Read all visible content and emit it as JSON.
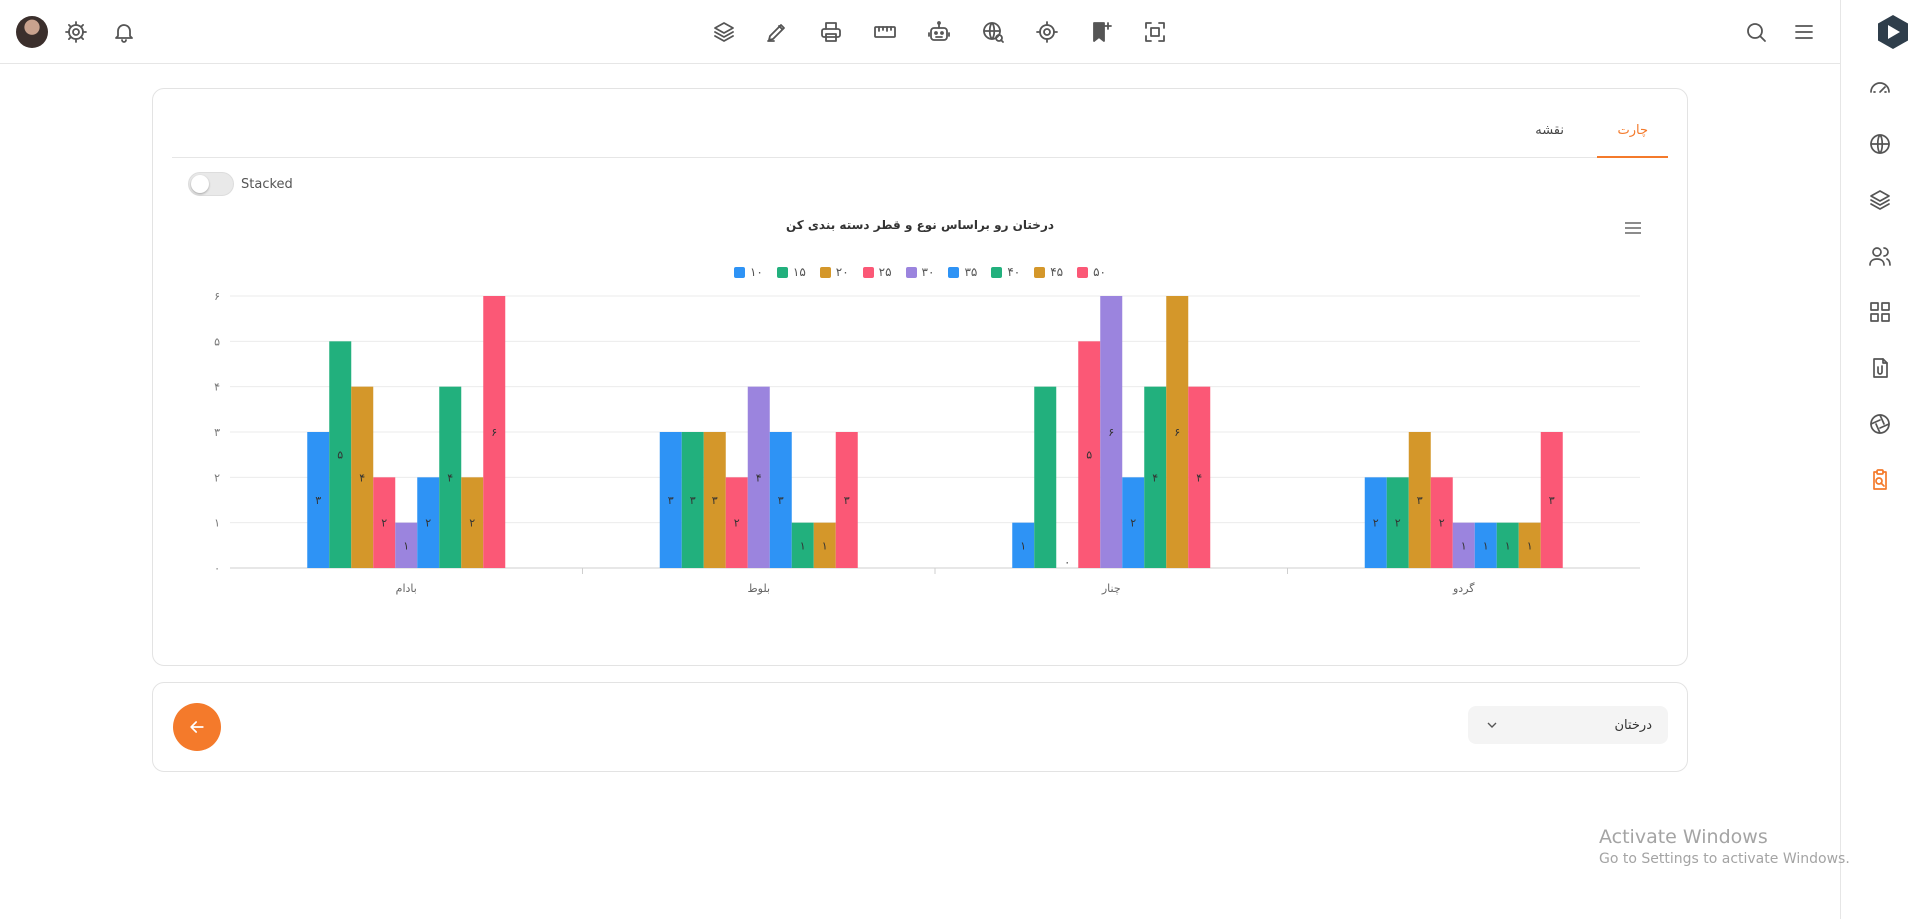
{
  "tabs": {
    "active": "چارت",
    "second": "نقشه"
  },
  "toggle": {
    "label": "Stacked",
    "on": false
  },
  "bottom": {
    "select_value": "درختان"
  },
  "watermark": {
    "line1": "Activate Windows",
    "line2": "Go to Settings to activate Windows."
  },
  "topbar_icons": [
    "avatar",
    "settings-icon",
    "bell-icon",
    "layers-icon",
    "edit-icon",
    "print-icon",
    "ruler-icon",
    "robot-icon",
    "globe-search-icon",
    "target-icon",
    "bookmark-add-icon",
    "scan-icon",
    "search-icon",
    "hamburger-icon"
  ],
  "sidebar_icons": [
    "speedometer-icon",
    "globe-icon",
    "layers-icon",
    "users-icon",
    "grid-icon",
    "file-attach-icon",
    "aperture-icon",
    "clipboard-search-icon"
  ],
  "accent_color": "#f47a2b",
  "chart_data": {
    "type": "bar",
    "title": "درختان رو براساس نوع و قطر دسته بندی کن",
    "xlabel": "",
    "ylabel": "",
    "ylim": [
      0,
      6
    ],
    "yticks": [
      "۰",
      "۱",
      "۲",
      "۳",
      "۴",
      "۵",
      "۶"
    ],
    "grid": true,
    "legend_position": "top",
    "categories": [
      "بادام",
      "بلوط",
      "چنار",
      "گردو"
    ],
    "series": [
      {
        "name": "۱۰",
        "color": "#2e93f5",
        "values": [
          3,
          3,
          1,
          2
        ],
        "labels": [
          "۳",
          "۳",
          "۱",
          "۲"
        ]
      },
      {
        "name": "۱۵",
        "color": "#22b07d",
        "values": [
          5,
          3,
          4,
          2
        ],
        "labels": [
          "۵",
          "۳",
          "",
          "۲"
        ]
      },
      {
        "name": "۲۰",
        "color": "#d4972a",
        "values": [
          4,
          3,
          0,
          3
        ],
        "labels": [
          "۴",
          "۳",
          "۰",
          "۳"
        ]
      },
      {
        "name": "۲۵",
        "color": "#fb5876",
        "values": [
          2,
          2,
          5,
          2
        ],
        "labels": [
          "۲",
          "۲",
          "۵",
          "۲"
        ]
      },
      {
        "name": "۳۰",
        "color": "#9b84de",
        "values": [
          1,
          4,
          6,
          1
        ],
        "labels": [
          "۱",
          "۴",
          "۶",
          "۱"
        ]
      },
      {
        "name": "۳۵",
        "color": "#2e93f5",
        "values": [
          2,
          3,
          2,
          1
        ],
        "labels": [
          "۲",
          "۳",
          "۲",
          "۱"
        ]
      },
      {
        "name": "۴۰",
        "color": "#22b07d",
        "values": [
          4,
          1,
          4,
          1
        ],
        "labels": [
          "۴",
          "۱",
          "۴",
          "۱"
        ]
      },
      {
        "name": "۴۵",
        "color": "#d4972a",
        "values": [
          2,
          1,
          6,
          1
        ],
        "labels": [
          "۲",
          "۱",
          "۶",
          "۱"
        ]
      },
      {
        "name": "۵۰",
        "color": "#fb5876",
        "values": [
          6,
          3,
          4,
          3
        ],
        "labels": [
          "۶",
          "۳",
          "۴",
          "۳"
        ]
      }
    ]
  }
}
